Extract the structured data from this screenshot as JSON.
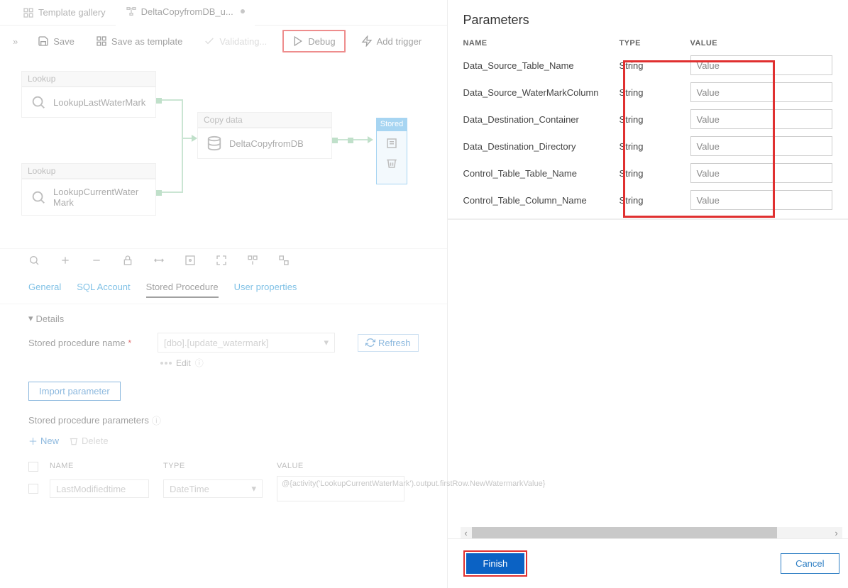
{
  "tabs": {
    "template_gallery": "Template gallery",
    "pipeline": "DeltaCopyfromDB_u..."
  },
  "toolbar": {
    "save": "Save",
    "save_template": "Save as template",
    "validating": "Validating...",
    "debug": "Debug",
    "add_trigger": "Add trigger"
  },
  "canvas": {
    "lookup_label": "Lookup",
    "lookup1_name": "LookupLastWaterMark",
    "lookup2_name_l1": "LookupCurrentWater",
    "lookup2_name_l2": "Mark",
    "copy_label": "Copy data",
    "copy_name": "DeltaCopyfromDB",
    "stored_label": "Stored"
  },
  "panel_tabs": {
    "general": "General",
    "sql": "SQL Account",
    "sp": "Stored Procedure",
    "user": "User properties"
  },
  "details": {
    "header": "Details",
    "sp_label": "Stored procedure name",
    "sp_value": "[dbo].[update_watermark]",
    "edit": "Edit",
    "refresh": "Refresh",
    "import": "Import parameter",
    "params_header": "Stored procedure parameters",
    "new": "New",
    "delete": "Delete",
    "col_name": "NAME",
    "col_type": "TYPE",
    "col_value": "VALUE",
    "r_name": "LastModifiedtime",
    "r_type": "DateTime",
    "r_value": "@{activity('LookupCurrentWaterMark').output.firstRow.NewWatermarkValue}"
  },
  "right": {
    "title": "Parameters",
    "headers": {
      "name": "NAME",
      "type": "TYPE",
      "value": "VALUE"
    },
    "placeholder": "Value",
    "rows": [
      {
        "name": "Data_Source_Table_Name",
        "type": "String"
      },
      {
        "name": "Data_Source_WaterMarkColumn",
        "type": "String"
      },
      {
        "name": "Data_Destination_Container",
        "type": "String"
      },
      {
        "name": "Data_Destination_Directory",
        "type": "String"
      },
      {
        "name": "Control_Table_Table_Name",
        "type": "String"
      },
      {
        "name": "Control_Table_Column_Name",
        "type": "String"
      }
    ],
    "finish": "Finish",
    "cancel": "Cancel"
  }
}
